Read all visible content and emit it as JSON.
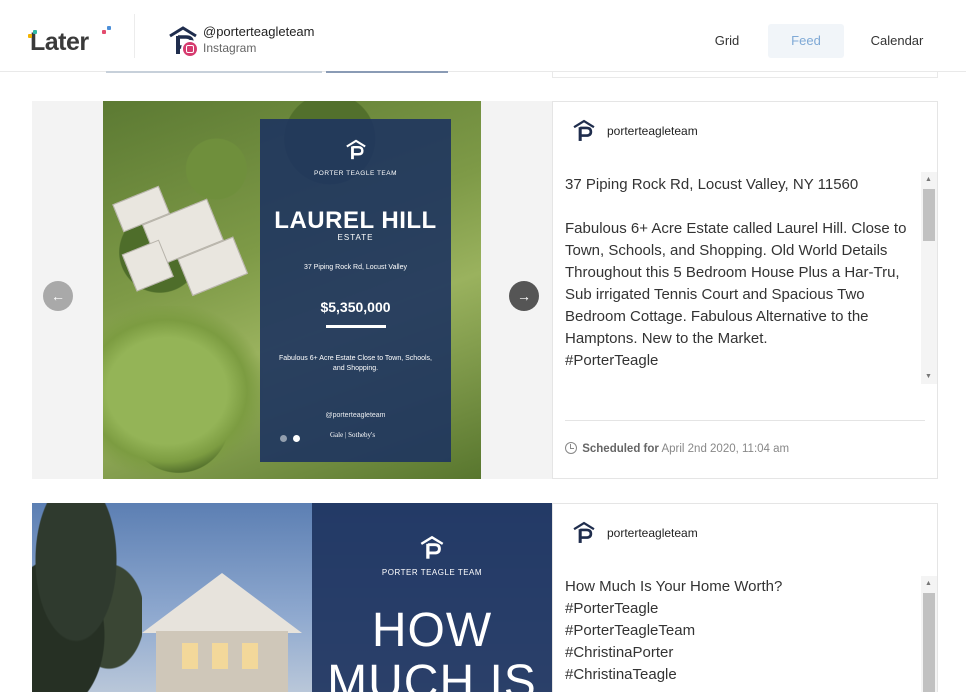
{
  "app": {
    "name": "Later"
  },
  "account": {
    "handle": "@porterteagleteam",
    "platform": "Instagram"
  },
  "nav": {
    "grid": "Grid",
    "feed": "Feed",
    "calendar": "Calendar",
    "active": "Feed"
  },
  "colors": {
    "accent": "#7fa9d6",
    "overlay": "#1e345f",
    "instagram": "#d63b6f"
  },
  "posts": [
    {
      "handle": "porterteagleteam",
      "media": {
        "team": "PORTER TEAGLE TEAM",
        "title": "LAUREL HILL",
        "subtitle": "ESTATE",
        "address": "37 Piping Rock Rd, Locust Valley",
        "price": "$5,350,000",
        "description": "Fabulous 6+ Acre Estate Close to Town, Schools, and Shopping.",
        "handle": "@porterteagleteam",
        "brand": "Gale | Sotheby's",
        "prev_icon": "arrow-left-icon",
        "next_icon": "arrow-right-icon"
      },
      "caption": {
        "address": "37 Piping Rock Rd, Locust Valley, NY 11560",
        "body": "Fabulous 6+ Acre Estate called Laurel Hill. Close to Town, Schools, and Shopping. Old World Details Throughout this 5 Bedroom House Plus a Har-Tru, Sub irrigated Tennis Court and Spacious Two Bedroom Cottage. Fabulous Alternative to the Hamptons. New to the Market.",
        "tags": "#PorterTeagle"
      },
      "schedule": {
        "label": "Scheduled for",
        "time": "April 2nd 2020, 11:04 am"
      }
    },
    {
      "handle": "porterteagleteam",
      "media": {
        "team": "PORTER TEAGLE TEAM",
        "line1": "HOW",
        "line2": "MUCH IS"
      },
      "caption": {
        "line1": "How Much Is Your Home Worth?",
        "line2": "#PorterTeagle",
        "line3": "#PorterTeagleTeam",
        "line4": "#ChristinaPorter",
        "line5": "#ChristinaTeagle"
      }
    }
  ]
}
